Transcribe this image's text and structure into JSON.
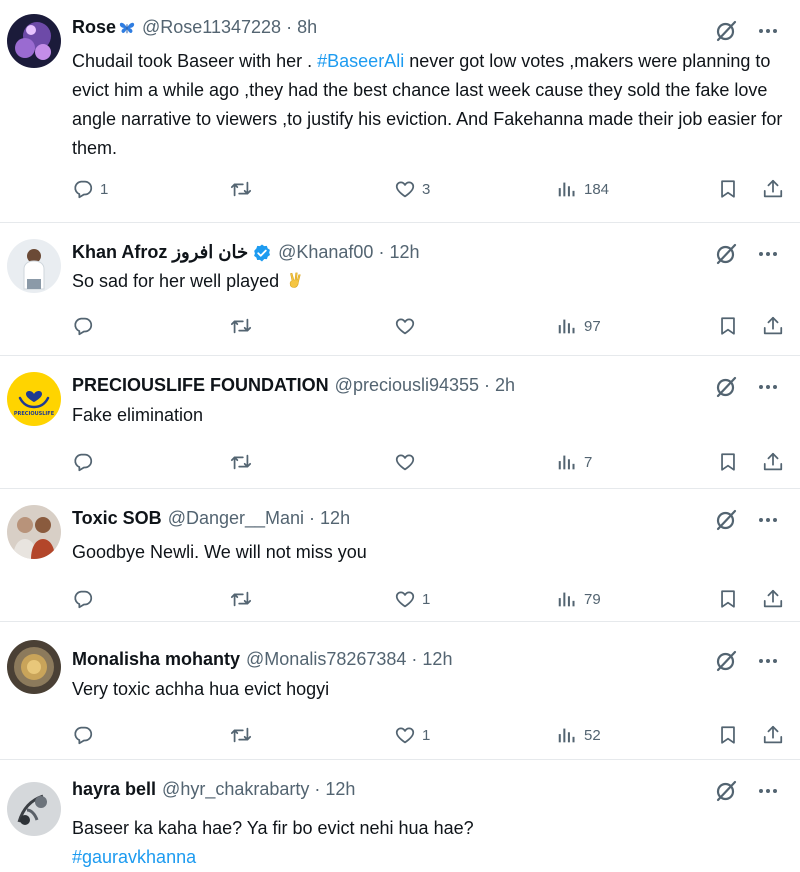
{
  "colors": {
    "text": "#0f1419",
    "muted": "#536471",
    "link": "#1d9bf0",
    "verified": "#1d9bf0",
    "divider": "#e6e9ec"
  },
  "tweets": [
    {
      "name": "Rose",
      "emoji": "butterfly-icon",
      "handle": "@Rose11347228",
      "sep": "·",
      "time": "8h",
      "text_parts": [
        "Chudail took Baseer with her . ",
        "#BaseerAli",
        " never got low votes ,makers were planning to evict him a while ago ,they had the best chance last week cause they sold the fake love angle narrative to viewers ,to justify his eviction. And Fakehanna made their job easier for them."
      ],
      "replies": "1",
      "retweets": "",
      "likes": "3",
      "views": "184"
    },
    {
      "name": "Khan Afroz خان افروز",
      "verified": true,
      "handle": "@Khanaf00",
      "sep": "·",
      "time": "12h",
      "text": "So sad for her well played",
      "emoji": "victory-hand-icon",
      "replies": "",
      "retweets": "",
      "likes": "",
      "views": "97"
    },
    {
      "name": "PRECIOUSLIFE FOUNDATION",
      "avatar_text": "PRECIOUSLIFE",
      "handle": "@preciousli94355",
      "sep": "·",
      "time": "2h",
      "text": "Fake elimination",
      "replies": "",
      "retweets": "",
      "likes": "",
      "views": "7"
    },
    {
      "name": "Toxic SOB",
      "handle": "@Danger__Mani",
      "sep": "·",
      "time": "12h",
      "text": "Goodbye Newli. We will not miss you",
      "replies": "",
      "retweets": "",
      "likes": "1",
      "views": "79"
    },
    {
      "name": "Monalisha mohanty",
      "handle": "@Monalis78267384",
      "sep": "·",
      "time": "12h",
      "text": "Very toxic achha hua evict hogyi",
      "replies": "",
      "retweets": "",
      "likes": "1",
      "views": "52"
    },
    {
      "name": "hayra bell",
      "handle": "@hyr_chakrabarty",
      "sep": "·",
      "time": "12h",
      "text": "Baseer ka kaha hae? Ya fir bo evict nehi hua hae?",
      "hashtag": "#gauravkhanna"
    }
  ]
}
